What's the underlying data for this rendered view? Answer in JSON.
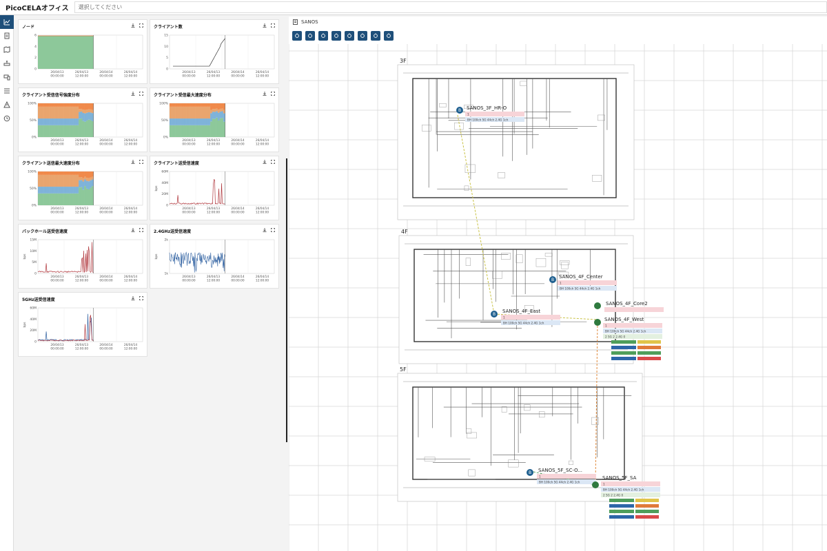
{
  "app": {
    "title": "PicoCELAオフィス",
    "search_placeholder": "選択してください",
    "accent_color": "#1e4f7a"
  },
  "sidebar": {
    "items": [
      {
        "icon": "chart-line-icon",
        "active": true
      },
      {
        "icon": "document-icon"
      },
      {
        "icon": "map-icon"
      },
      {
        "icon": "router-icon"
      },
      {
        "icon": "devices-icon"
      },
      {
        "icon": "list-icon"
      },
      {
        "icon": "warning-icon"
      },
      {
        "icon": "history-icon"
      }
    ]
  },
  "charts": [
    {
      "title": "ノード",
      "kind": "area_full",
      "yticks": [
        "6",
        "4",
        "2",
        "0"
      ],
      "xticks": [
        "26/04/13\n00:00:00",
        "26/04/13\n12:00:00",
        "26/04/14\n00:00:00",
        "26/04/14\n12:00:00"
      ]
    },
    {
      "title": "クライアント数",
      "kind": "step",
      "yticks": [
        "15",
        "10",
        "5",
        "0"
      ],
      "xticks": [
        "26/04/13\n00:00:00",
        "26/04/13\n12:00:00",
        "26/04/14\n00:00:00",
        "26/04/14\n12:00:00"
      ]
    },
    {
      "title": "クライアント受信信号強度分布",
      "kind": "stacked_pct",
      "yticks": [
        "100%",
        "50%",
        "0%"
      ],
      "xticks": [
        "26/04/13\n00:00:00",
        "26/04/13\n12:00:00",
        "26/04/14\n00:00:00",
        "26/04/14\n12:00:00"
      ]
    },
    {
      "title": "クライアント受信最大速度分布",
      "kind": "stacked_pct",
      "yticks": [
        "100%",
        "50%",
        "0%"
      ],
      "xticks": [
        "26/04/13\n00:00:00",
        "26/04/13\n12:00:00",
        "26/04/14\n00:00:00",
        "26/04/14\n12:00:00"
      ]
    },
    {
      "title": "クライアント送信最大速度分布",
      "kind": "stacked_pct",
      "yticks": [
        "100%",
        "50%",
        "0%"
      ],
      "xticks": [
        "26/04/13\n00:00:00",
        "26/04/13\n12:00:00",
        "26/04/14\n00:00:00",
        "26/04/14\n12:00:00"
      ]
    },
    {
      "title": "クライアント送受信速度",
      "kind": "spikes_red",
      "yticks": [
        "60M",
        "40M",
        "20M",
        "0"
      ],
      "ylabel": "bps",
      "xticks": [
        "26/04/13\n00:00:00",
        "26/04/13\n12:00:00",
        "26/04/14\n00:00:00",
        "26/04/14\n12:00:00"
      ]
    },
    {
      "title": "バックホール送受信速度",
      "kind": "spikes_red",
      "yticks": [
        "15M",
        "10M",
        "5M",
        "0"
      ],
      "ylabel": "bps",
      "xticks": [
        "26/04/13\n00:00:00",
        "26/04/13\n12:00:00",
        "26/04/14\n00:00:00",
        "26/04/14\n12:00:00"
      ]
    },
    {
      "title": "2.4GHz送受信速度",
      "kind": "noise_blue",
      "yticks": [
        "2k",
        "1k"
      ],
      "ylabel": "bps",
      "xticks": [
        "26/04/13\n00:00:00",
        "26/04/13\n12:00:00",
        "26/04/14\n00:00:00",
        "26/04/14\n12:00:00"
      ]
    },
    {
      "title": "5GHz送受信速度",
      "kind": "spikes_mixed",
      "yticks": [
        "60M",
        "40M",
        "20M",
        "0"
      ],
      "ylabel": "bps",
      "xticks": [
        "26/04/13\n00:00:00",
        "26/04/13\n12:00:00",
        "26/04/14\n00:00:00",
        "26/04/14\n12:00:00"
      ]
    }
  ],
  "map_view": {
    "title": "SANOS",
    "toolbar_icons": [
      "pin-icon",
      "sliders-icon",
      "lock-icon",
      "wifi-icon",
      "devices-icon",
      "bar-chart-icon",
      "crosshair-icon",
      "signal-icon"
    ],
    "floors": [
      "3F",
      "4F",
      "5F"
    ],
    "nodes": [
      {
        "name": "SANOS_3F_HR-O",
        "badge": "B"
      },
      {
        "name": "SANOS_4F_Center",
        "badge": "B"
      },
      {
        "name": "SANOS_4F_East",
        "badge": "B"
      },
      {
        "name": "SANOS_4F_Core2",
        "badge": ""
      },
      {
        "name": "SANOS_4F_West",
        "badge": ""
      },
      {
        "name": "SANOS_5F_SC-O...",
        "badge": "B"
      },
      {
        "name": "SANOS_5F_SA",
        "badge": ""
      }
    ],
    "node_info": {
      "channels": "BH 100ch  5G 44ch  2.4G 1ch",
      "clients": "2   5G 2   2.4G 0",
      "alarm": "1"
    }
  }
}
